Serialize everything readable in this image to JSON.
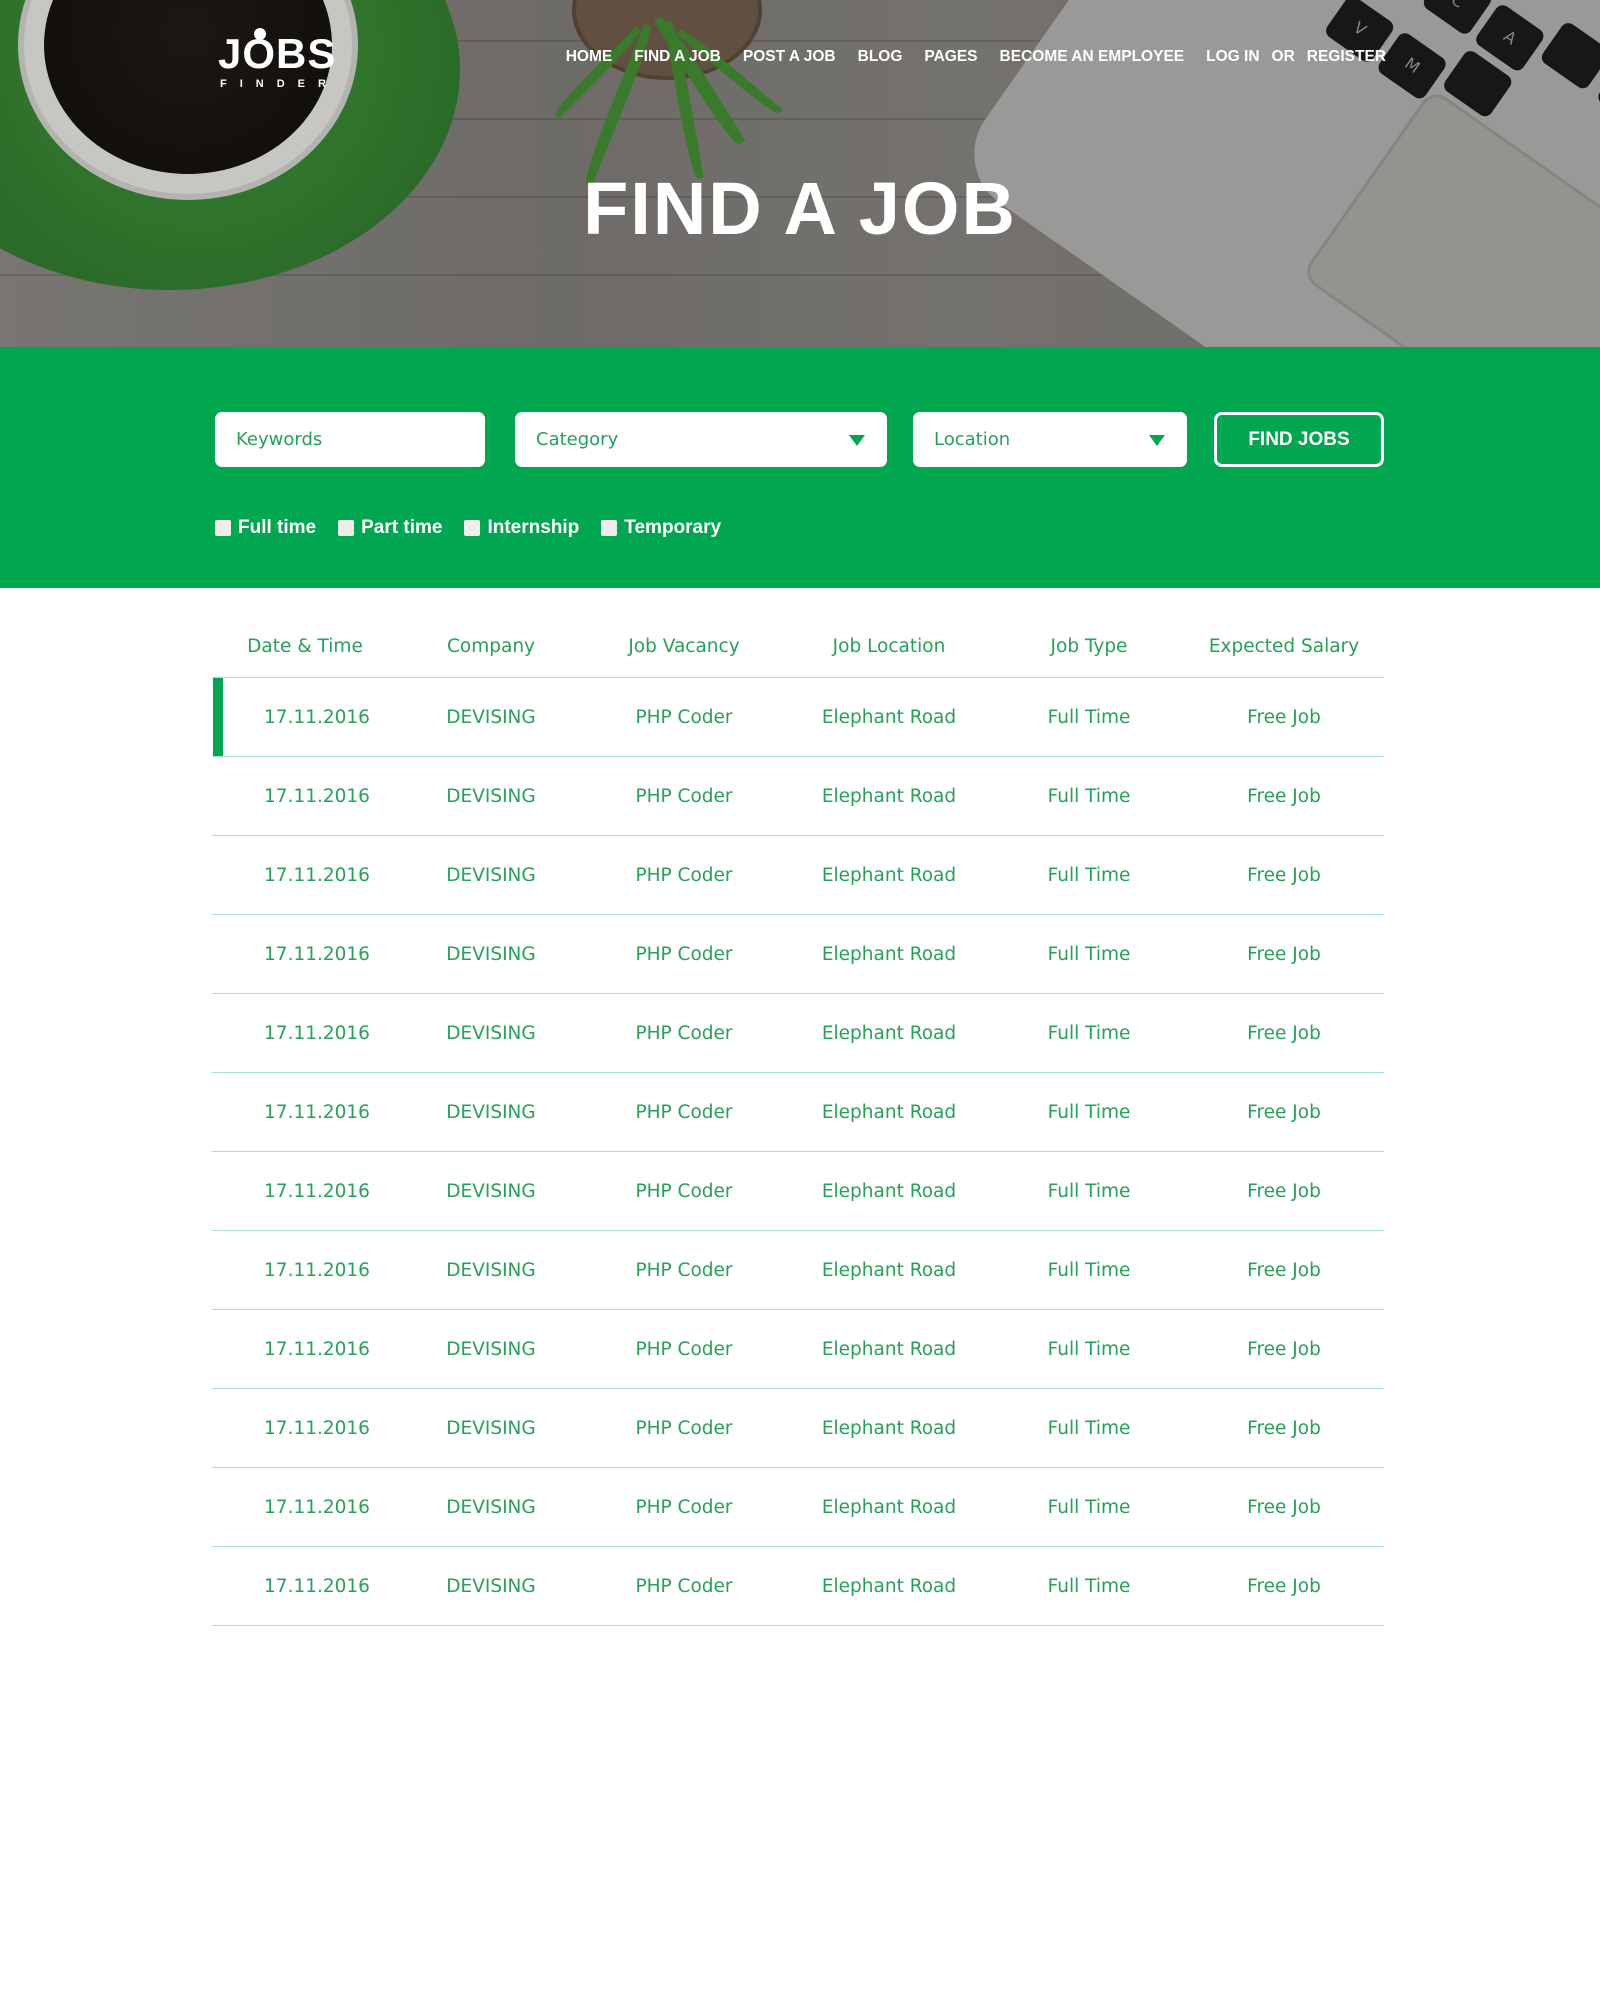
{
  "brand": {
    "name": "JOBS",
    "tagline": "FINDER"
  },
  "nav": {
    "items": [
      "HOME",
      "FIND A JOB",
      "POST A JOB",
      "BLOG",
      "PAGES",
      "BECOME AN EMPLOYEE"
    ],
    "login": "LOG IN",
    "or": "OR",
    "register": "REGISTER"
  },
  "hero": {
    "title": "FIND A JOB"
  },
  "search": {
    "keywords_placeholder": "Keywords",
    "category_placeholder": "Category",
    "location_placeholder": "Location",
    "button_label": "FIND JOBS",
    "filters": [
      "Full time",
      "Part time",
      "Internship",
      "Temporary"
    ]
  },
  "table": {
    "headers": [
      "Date & Time",
      "Company",
      "Job Vacancy",
      "Job Location",
      "Job Type",
      "Expected Salary"
    ],
    "rows": [
      [
        "17.11.2016",
        "DEVISING",
        "PHP Coder",
        "Elephant Road",
        "Full Time",
        "Free Job"
      ],
      [
        "17.11.2016",
        "DEVISING",
        "PHP Coder",
        "Elephant Road",
        "Full Time",
        "Free Job"
      ],
      [
        "17.11.2016",
        "DEVISING",
        "PHP Coder",
        "Elephant Road",
        "Full Time",
        "Free Job"
      ],
      [
        "17.11.2016",
        "DEVISING",
        "PHP Coder",
        "Elephant Road",
        "Full Time",
        "Free Job"
      ],
      [
        "17.11.2016",
        "DEVISING",
        "PHP Coder",
        "Elephant Road",
        "Full Time",
        "Free Job"
      ],
      [
        "17.11.2016",
        "DEVISING",
        "PHP Coder",
        "Elephant Road",
        "Full Time",
        "Free Job"
      ],
      [
        "17.11.2016",
        "DEVISING",
        "PHP Coder",
        "Elephant Road",
        "Full Time",
        "Free Job"
      ],
      [
        "17.11.2016",
        "DEVISING",
        "PHP Coder",
        "Elephant Road",
        "Full Time",
        "Free Job"
      ],
      [
        "17.11.2016",
        "DEVISING",
        "PHP Coder",
        "Elephant Road",
        "Full Time",
        "Free Job"
      ],
      [
        "17.11.2016",
        "DEVISING",
        "PHP Coder",
        "Elephant Road",
        "Full Time",
        "Free Job"
      ],
      [
        "17.11.2016",
        "DEVISING",
        "PHP Coder",
        "Elephant Road",
        "Full Time",
        "Free Job"
      ],
      [
        "17.11.2016",
        "DEVISING",
        "PHP Coder",
        "Elephant Road",
        "Full Time",
        "Free Job"
      ]
    ]
  },
  "colors": {
    "brand_green": "#00a650",
    "text_green": "#27a05a",
    "divider": "#a8e0c4",
    "white": "#ffffff"
  }
}
